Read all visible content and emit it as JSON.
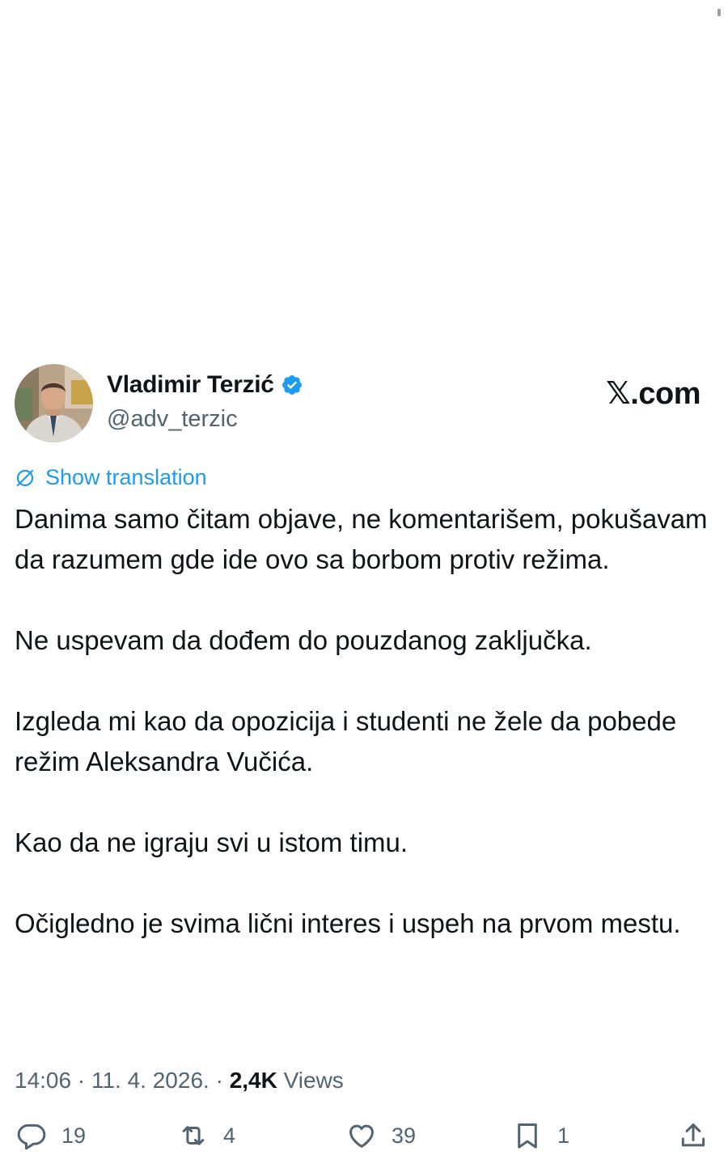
{
  "author": {
    "name": "Vladimir Terzić",
    "handle": "@adv_terzic",
    "verified": true
  },
  "brand": {
    "x_glyph": "𝕏",
    "domain": ".com"
  },
  "translation": {
    "label": "Show translation"
  },
  "tweet": {
    "paragraphs": [
      "Danima samo čitam objave, ne komentarišem, pokušavam da razumem gde ide ovo sa borbom protiv režima.",
      "Ne uspevam da dođem do pouzdanog zaključka.",
      "Izgleda mi kao da opozicija i studenti ne žele da pobede režim Aleksandra Vučića.",
      "Kao da ne igraju svi u istom timu.",
      "Očigledno je svima lični interes i uspeh na prvom mestu."
    ]
  },
  "meta": {
    "time": "14:06",
    "separator": " · ",
    "date": "11. 4. 2026.",
    "views_count": "2,4K",
    "views_label": "Views"
  },
  "actions": {
    "replies": "19",
    "reposts": "4",
    "likes": "39",
    "bookmarks": "1"
  },
  "colors": {
    "accent": "#1d9bf0",
    "text_primary": "#0f1419",
    "text_secondary": "#536471"
  }
}
